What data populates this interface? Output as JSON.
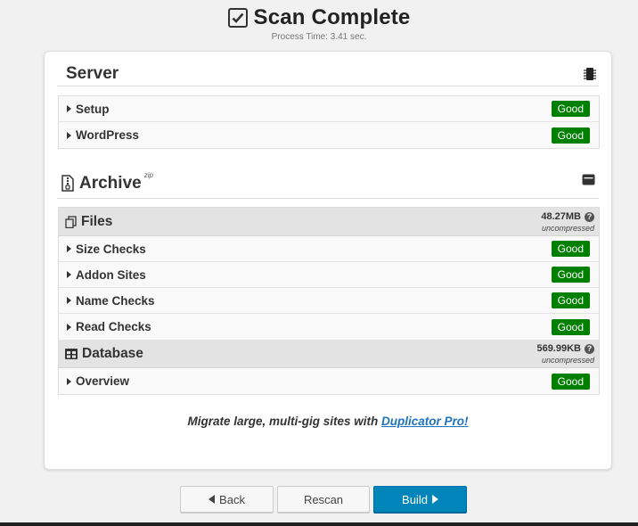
{
  "header": {
    "title": "Scan Complete",
    "process_time": "Process Time: 3.41 sec."
  },
  "server": {
    "title": "Server",
    "icon": "chip-icon",
    "rows": [
      {
        "label": "Setup",
        "status": "Good"
      },
      {
        "label": "WordPress",
        "status": "Good"
      }
    ]
  },
  "archive": {
    "title": "Archive",
    "title_sup": "zip",
    "icon": "archive-box-icon",
    "files": {
      "title": "Files",
      "size": "48.27MB",
      "size_note": "uncompressed",
      "rows": [
        {
          "label": "Size Checks",
          "status": "Good"
        },
        {
          "label": "Addon Sites",
          "status": "Good"
        },
        {
          "label": "Name Checks",
          "status": "Good"
        },
        {
          "label": "Read Checks",
          "status": "Good"
        }
      ]
    },
    "database": {
      "title": "Database",
      "size": "569.99KB",
      "size_note": "uncompressed",
      "rows": [
        {
          "label": "Overview",
          "status": "Good"
        }
      ]
    }
  },
  "promo": {
    "text": "Migrate large, multi-gig sites with",
    "link": "Duplicator Pro!"
  },
  "buttons": {
    "back": "Back",
    "rescan": "Rescan",
    "build": "Build"
  },
  "colors": {
    "good": "#008000",
    "primary": "#0085ba",
    "link": "#1e73be"
  }
}
